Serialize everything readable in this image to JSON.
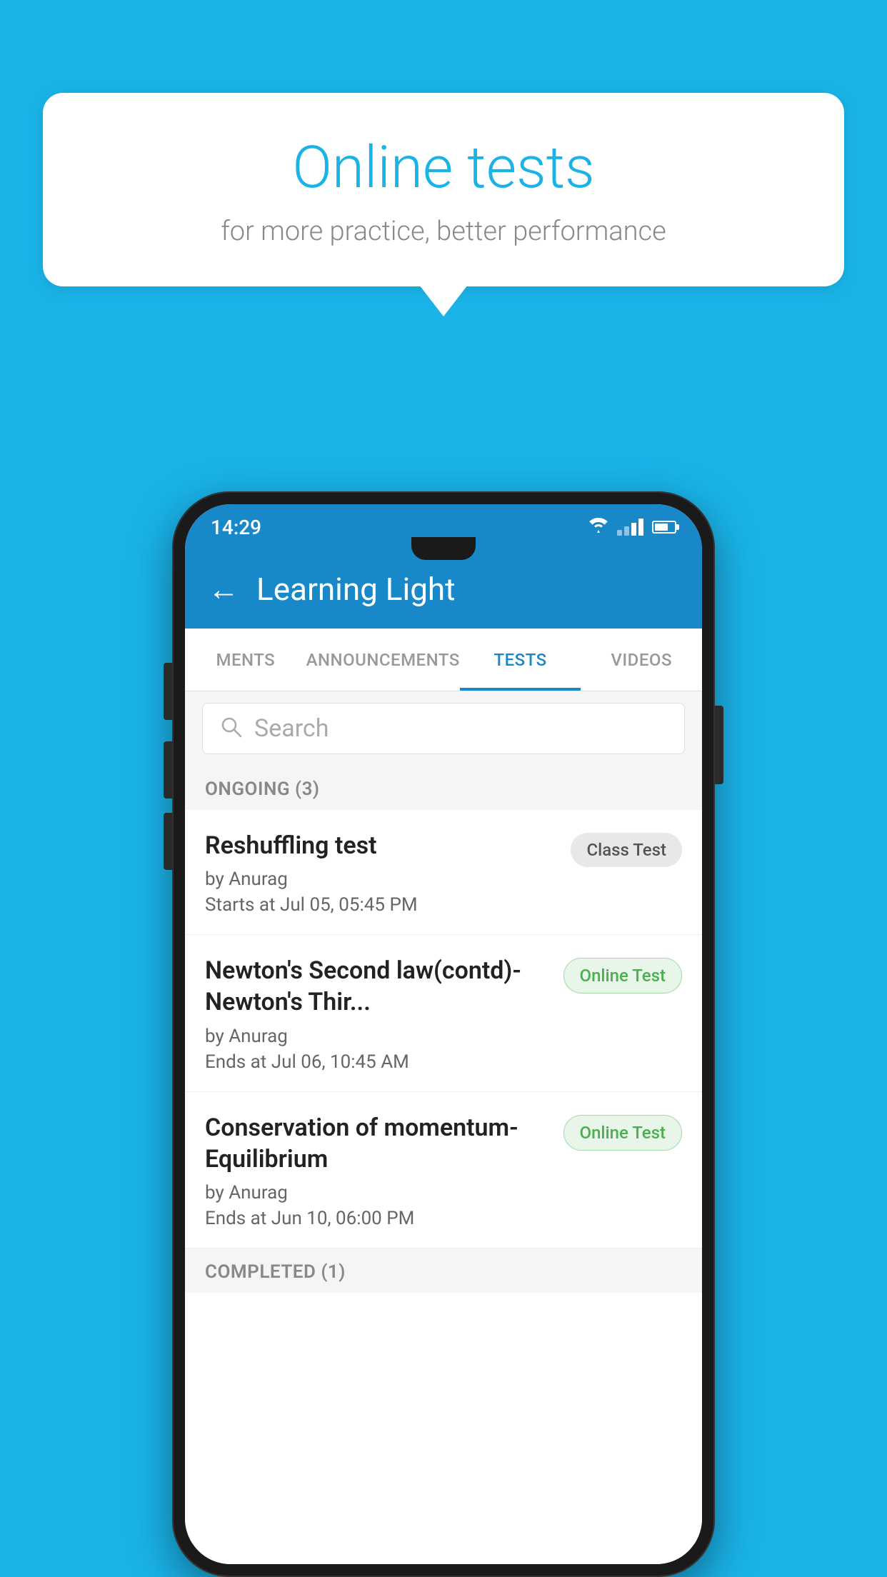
{
  "background": {
    "color": "#1ab3e8"
  },
  "speech_bubble": {
    "title": "Online tests",
    "subtitle": "for more practice, better performance"
  },
  "phone": {
    "status_bar": {
      "time": "14:29",
      "wifi": "▼",
      "battery_percent": 70
    },
    "app_bar": {
      "back_label": "←",
      "title": "Learning Light"
    },
    "tabs": [
      {
        "label": "MENTS",
        "active": false
      },
      {
        "label": "ANNOUNCEMENTS",
        "active": false
      },
      {
        "label": "TESTS",
        "active": true
      },
      {
        "label": "VIDEOS",
        "active": false
      }
    ],
    "search": {
      "placeholder": "Search"
    },
    "sections": [
      {
        "header": "ONGOING (3)",
        "items": [
          {
            "title": "Reshuffling test",
            "author": "by Anurag",
            "time": "Starts at  Jul 05, 05:45 PM",
            "badge": "Class Test",
            "badge_type": "class"
          },
          {
            "title": "Newton's Second law(contd)-Newton's Thir...",
            "author": "by Anurag",
            "time": "Ends at  Jul 06, 10:45 AM",
            "badge": "Online Test",
            "badge_type": "online"
          },
          {
            "title": "Conservation of momentum-Equilibrium",
            "author": "by Anurag",
            "time": "Ends at  Jun 10, 06:00 PM",
            "badge": "Online Test",
            "badge_type": "online"
          }
        ]
      },
      {
        "header": "COMPLETED (1)",
        "items": []
      }
    ]
  }
}
